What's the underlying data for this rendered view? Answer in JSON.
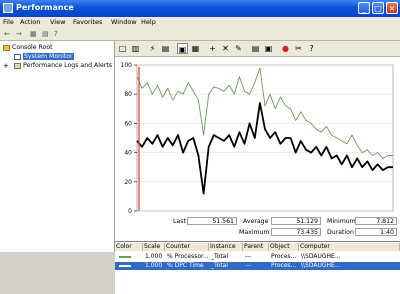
{
  "window": {
    "title": "Performance",
    "min_label": "_",
    "max_label": "□",
    "close_label": "×"
  },
  "menu": [
    "File",
    "Action",
    "View",
    "Favorites",
    "Window",
    "Help"
  ],
  "toolbar1": [
    "←",
    "→",
    "▦",
    "▤",
    "?"
  ],
  "tree": {
    "root": "Console Root",
    "items": [
      {
        "label": "System Monitor",
        "selected": true
      },
      {
        "label": "Performance Logs and Alerts",
        "expander": "+",
        "selected": false
      }
    ]
  },
  "toolbar2": [
    "□",
    "▥",
    "⚡",
    "▤",
    "▣",
    "▦",
    "+",
    "✕",
    "✎",
    "▤",
    "▣",
    "●",
    "✂",
    "?"
  ],
  "colors": {
    "processor": "#6a9a5a",
    "dpc": "#000000",
    "cursor": "#e23b2e",
    "selection": "#316ac5"
  },
  "chart_data": {
    "type": "line",
    "ylim": [
      0,
      100
    ],
    "y_ticks": [
      "100",
      "80",
      "60",
      "40",
      "20",
      "0"
    ],
    "x": [
      0,
      2,
      4,
      6,
      8,
      10,
      12,
      14,
      16,
      18,
      20,
      22,
      24,
      26,
      28,
      30,
      32,
      34,
      36,
      38,
      40,
      42,
      44,
      46,
      48,
      50,
      52,
      54,
      56,
      58,
      60,
      62,
      64,
      66,
      68,
      70,
      72,
      74,
      76,
      78,
      80,
      82,
      84,
      86,
      88,
      90,
      92,
      94,
      96,
      98,
      100
    ],
    "series": [
      {
        "color": "#6a9a5a",
        "values": [
          92,
          84,
          88,
          80,
          86,
          78,
          84,
          76,
          82,
          80,
          88,
          82,
          76,
          52,
          80,
          85,
          84,
          82,
          86,
          80,
          92,
          82,
          80,
          88,
          98,
          72,
          80,
          70,
          78,
          72,
          70,
          62,
          68,
          62,
          60,
          56,
          54,
          58,
          52,
          50,
          48,
          46,
          52,
          45,
          40,
          42,
          38,
          40,
          36,
          38,
          38
        ]
      },
      {
        "color": "#000000",
        "values": [
          48,
          44,
          50,
          46,
          52,
          44,
          50,
          45,
          52,
          40,
          48,
          50,
          38,
          12,
          44,
          52,
          50,
          48,
          52,
          44,
          54,
          46,
          60,
          50,
          74,
          56,
          50,
          54,
          46,
          50,
          50,
          40,
          48,
          42,
          40,
          44,
          38,
          44,
          36,
          38,
          32,
          38,
          30,
          36,
          30,
          34,
          28,
          32,
          28,
          30,
          30
        ]
      }
    ]
  },
  "stats": {
    "last_label": "Last",
    "last": "51.561",
    "average_label": "Average",
    "average": "51.129",
    "minimum_label": "Minimum",
    "minimum": "7.812",
    "maximum_label": "Maximum",
    "maximum": "73.435",
    "duration_label": "Duration",
    "duration": "1:40"
  },
  "legend": {
    "headers": [
      "Color",
      "Scale",
      "Counter",
      "Instance",
      "Parent",
      "Object",
      "Computer"
    ],
    "rows": [
      {
        "color": "#6a9a5a",
        "scale": "1.000",
        "counter": "% Processor...",
        "instance": "_Total",
        "parent": "---",
        "object": "Proces...",
        "computer": "\\\\SDAUGHE...",
        "selected": false
      },
      {
        "color": "#000000",
        "scale": "1.000",
        "counter": "% DPC Time",
        "instance": "_Total",
        "parent": "---",
        "object": "Proces...",
        "computer": "\\\\SDAUGHE...",
        "selected": true
      }
    ]
  }
}
